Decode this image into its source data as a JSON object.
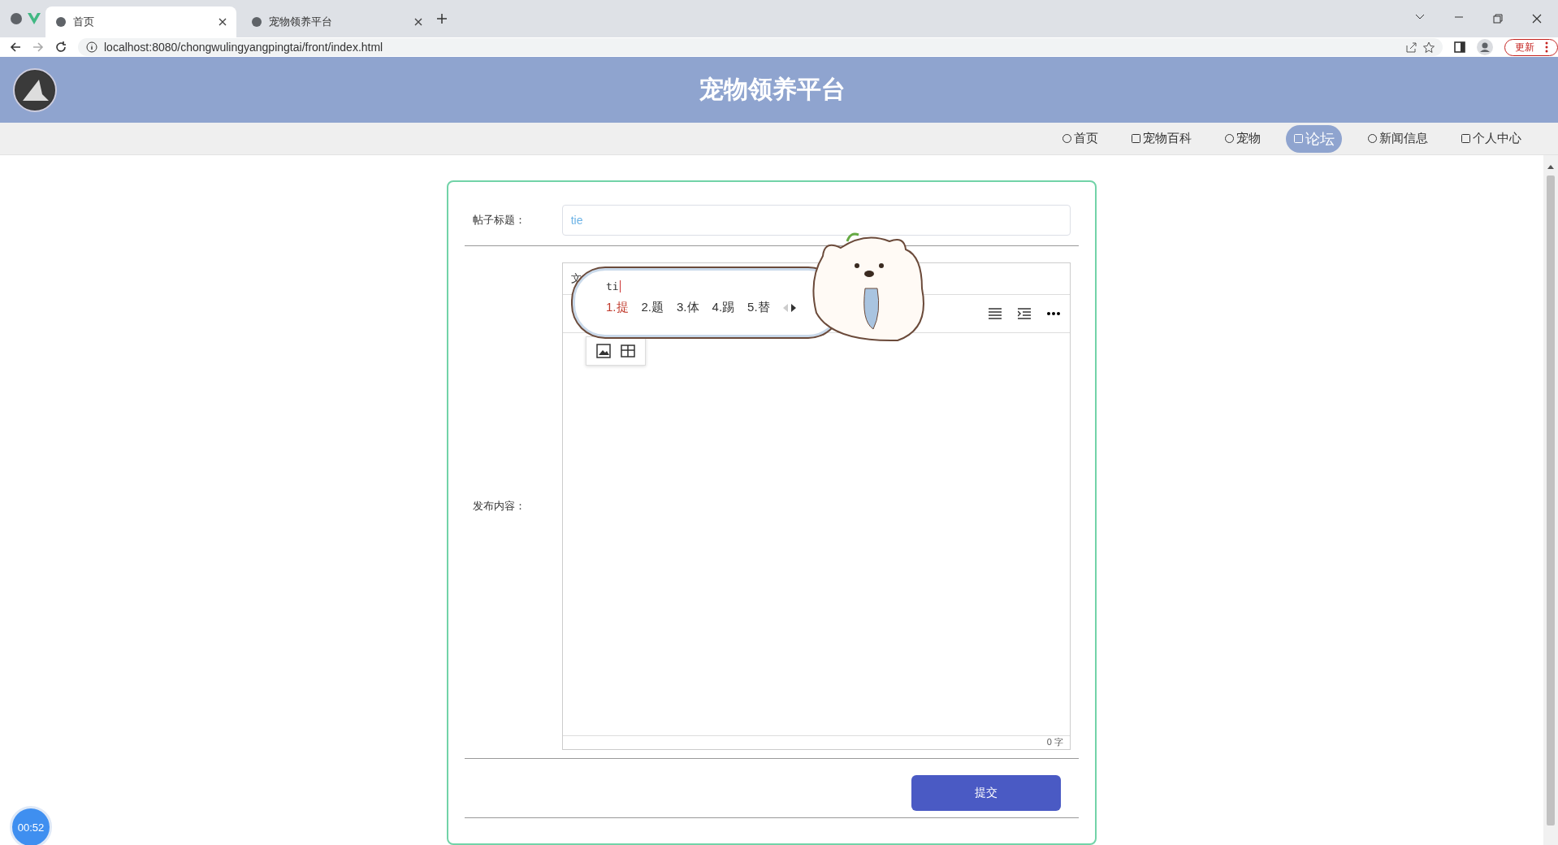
{
  "browser": {
    "tabs": [
      {
        "title": "首页",
        "selected": true
      },
      {
        "title": "宠物领养平台",
        "selected": false
      }
    ],
    "url": "localhost:8080/chongwulingyangpingtai/front/index.html",
    "update_button": "更新"
  },
  "header": {
    "title": "宠物领养平台"
  },
  "nav": [
    {
      "label": "首页",
      "selected": false
    },
    {
      "label": "宠物百科",
      "selected": false
    },
    {
      "label": "宠物",
      "selected": false
    },
    {
      "label": "论坛",
      "selected": true
    },
    {
      "label": "新闻信息",
      "selected": false
    },
    {
      "label": "个人中心",
      "selected": false
    }
  ],
  "form": {
    "title_label": "帖子标题：",
    "title_value": "tie",
    "content_label": "发布内容：",
    "editor_menu": "文",
    "char_count": "0 字",
    "submit": "提交"
  },
  "ime": {
    "input": "ti",
    "candidates": [
      {
        "text": "1.提",
        "selected": true
      },
      {
        "text": "2.题",
        "selected": false
      },
      {
        "text": "3.体",
        "selected": false
      },
      {
        "text": "4.踢",
        "selected": false
      },
      {
        "text": "5.替",
        "selected": false
      }
    ]
  },
  "timer": "00:52"
}
